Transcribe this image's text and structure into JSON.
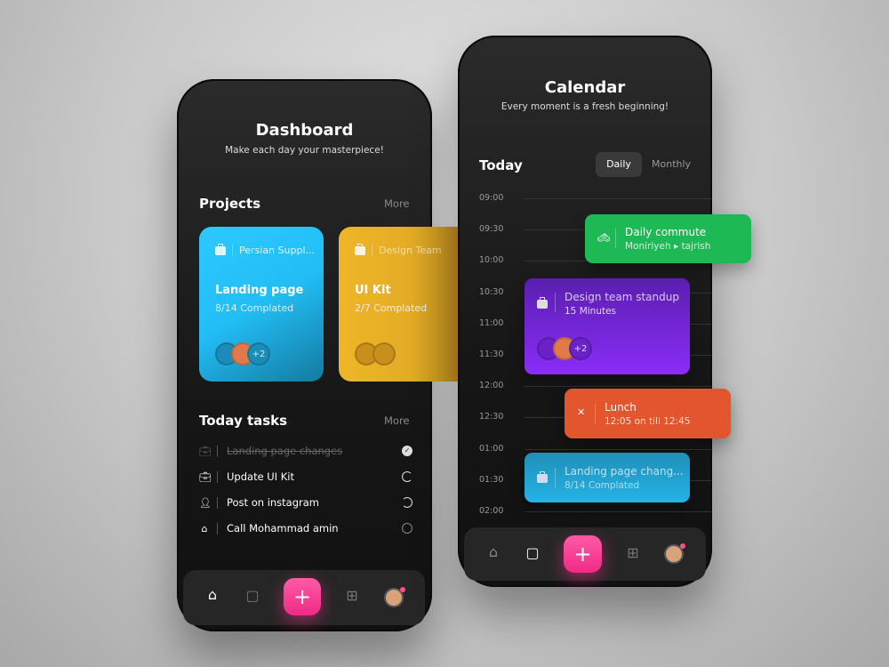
{
  "dashboard": {
    "title": "Dashboard",
    "subtitle": "Make each day your masterpiece!",
    "projects_heading": "Projects",
    "projects_more": "More",
    "projects": [
      {
        "category": "Persian Suppl...",
        "title": "Landing page",
        "progress": "8/14 Complated",
        "extra_members": "+2",
        "color": "#27c4fa"
      },
      {
        "category": "Design Team",
        "title": "UI Kit",
        "progress": "2/7 Complated",
        "color": "#efb526"
      }
    ],
    "tasks_heading": "Today tasks",
    "tasks_more": "More",
    "tasks": [
      {
        "icon": "briefcase-icon",
        "label": "Landing page changes",
        "done": true
      },
      {
        "icon": "briefcase-icon",
        "label": "Update UI Kit",
        "done": false
      },
      {
        "icon": "user-icon",
        "label": "Post on instagram",
        "done": false
      },
      {
        "icon": "home-icon",
        "label": "Call Mohammad amin",
        "done": false
      }
    ],
    "nav": {
      "plus": "+"
    }
  },
  "calendar": {
    "title": "Calendar",
    "subtitle": "Every moment is a fresh beginning!",
    "today": "Today",
    "tabs": [
      {
        "label": "Daily",
        "active": true
      },
      {
        "label": "Monthly",
        "active": false
      }
    ],
    "times": [
      "09:00",
      "09:30",
      "10:00",
      "10:30",
      "11:00",
      "11:30",
      "12:00",
      "12:30",
      "01:00",
      "01:30",
      "02:00"
    ],
    "events": [
      {
        "icon": "taxi-icon",
        "title": "Daily commute",
        "meta": "Moniriyeh ▸ tajrish",
        "color": "#1cb954"
      },
      {
        "icon": "briefcase-icon",
        "title": "Design team standup",
        "meta": "15 Minutes",
        "extra_members": "+2",
        "color": "#7a2cf0"
      },
      {
        "icon": "cutlery-icon",
        "title": "Lunch",
        "meta": "12:05 on till 12:45",
        "color": "#e2552d"
      },
      {
        "icon": "briefcase-icon",
        "title": "Landing page chang...",
        "meta": "8/14 Complated",
        "color": "#23aedd"
      }
    ],
    "nav": {
      "plus": "+"
    }
  }
}
